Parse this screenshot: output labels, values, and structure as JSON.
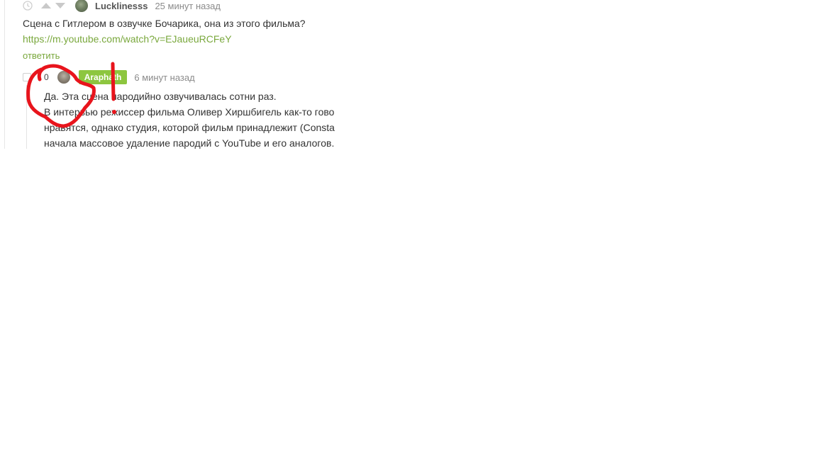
{
  "comments": [
    {
      "username": "Lucklinesss",
      "timestamp": "25 минут назад",
      "text": "Сцена с Гитлером в озвучке Бочарика, она из этого фильма?",
      "link": "https://m.youtube.com/watch?v=EJaueuRCFeY",
      "reply_label": "ответить",
      "icons": [
        "clock-icon",
        "upvote-icon",
        "downvote-icon",
        "avatar"
      ]
    },
    {
      "score": "0",
      "username": "Araphath",
      "timestamp": "6 минут назад",
      "lines": [
        "Да. Эта сцена пародийно озвучивалась сотни раз.",
        "В интервью режиссер фильма Оливер Хиршбигель как-то гово",
        "нравятся, однако студия, которой фильм принадлежит (Consta",
        "начала массовое удаление пародий с YouTube и его аналогов."
      ],
      "badge_color": "#8dc63f",
      "icons": [
        "collapse-icon",
        "avatar"
      ]
    }
  ],
  "colors": {
    "link": "#7aa83d",
    "badge": "#8dc63f",
    "annotation": "#e8141c"
  }
}
